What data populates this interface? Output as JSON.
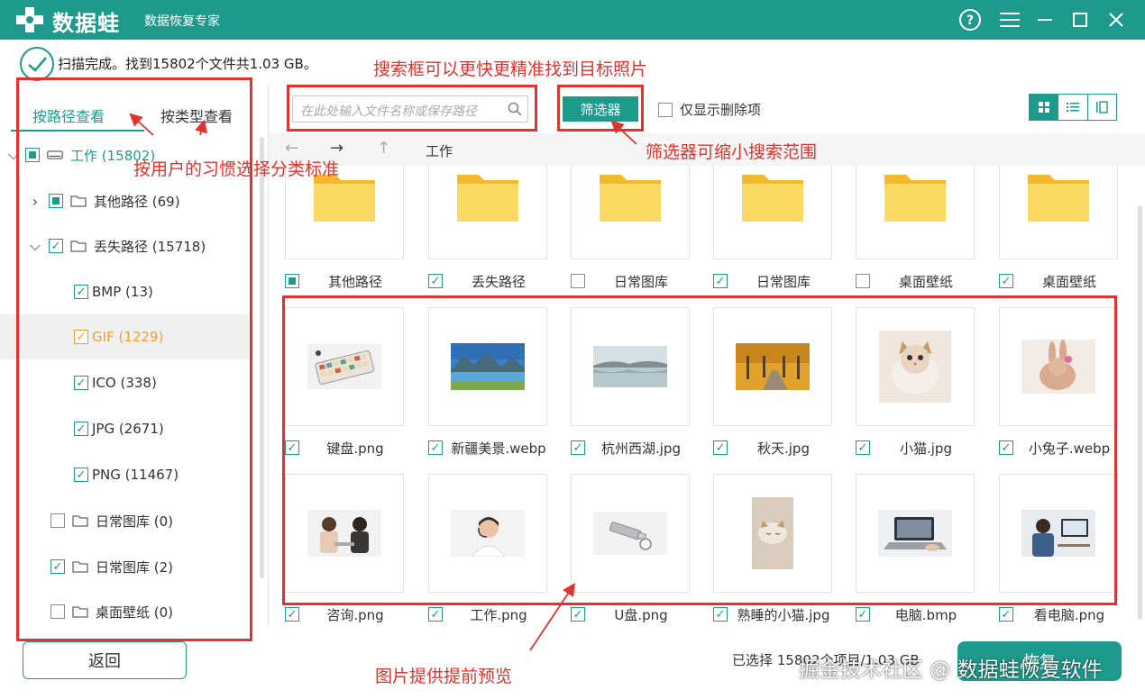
{
  "app": {
    "name": "数据蛙",
    "subtitle": "数据恢复专家"
  },
  "status": {
    "text": "扫描完成。找到15802个文件共1.03 GB。"
  },
  "annotations": {
    "search_tip": "搜索框可以更快更精准找到目标照片",
    "classify_tip": "按用户的习惯选择分类标准",
    "filter_tip": "筛选器可缩小搜索范围",
    "preview_tip": "图片提供提前预览"
  },
  "sidebar": {
    "tabs": [
      {
        "label": "按路径查看"
      },
      {
        "label": "按类型查看"
      }
    ],
    "tree": [
      {
        "label": "工作 (15802)",
        "state": "partial"
      },
      {
        "label": "其他路径 (69)",
        "state": "partial"
      },
      {
        "label": "丢失路径 (15718)",
        "state": "checked"
      },
      {
        "label": "BMP (13)",
        "state": "checked"
      },
      {
        "label": "GIF (1229)",
        "state": "checked"
      },
      {
        "label": "ICO (338)",
        "state": "checked"
      },
      {
        "label": "JPG (2671)",
        "state": "checked"
      },
      {
        "label": "PNG (11467)",
        "state": "checked"
      },
      {
        "label": "日常图库 (0)",
        "state": "unchecked"
      },
      {
        "label": "日常图库 (2)",
        "state": "checked"
      },
      {
        "label": "桌面壁纸 (0)",
        "state": "unchecked"
      }
    ]
  },
  "toolbar": {
    "search_placeholder": "在此处输入文件名称或保存路径",
    "filter_label": "筛选器",
    "only_deleted_label": "仅显示删除项"
  },
  "nav": {
    "breadcrumb": "工作",
    "back_arrow": "←",
    "forward_arrow": "→",
    "up_arrow": "↑"
  },
  "folders": [
    {
      "name": "其他路径",
      "state": "partial"
    },
    {
      "name": "丢失路径",
      "state": "checked"
    },
    {
      "name": "日常图库",
      "state": "unchecked"
    },
    {
      "name": "日常图库",
      "state": "checked"
    },
    {
      "name": "桌面壁纸",
      "state": "unchecked"
    },
    {
      "name": "桌面壁纸",
      "state": "checked"
    }
  ],
  "images": [
    {
      "name": "键盘.png",
      "icon": "keyboard-photo"
    },
    {
      "name": "新疆美景.webp",
      "icon": "lake-mountain-photo"
    },
    {
      "name": "杭州西湖.jpg",
      "icon": "west-lake-photo"
    },
    {
      "name": "秋天.jpg",
      "icon": "autumn-road-photo"
    },
    {
      "name": "小猫.jpg",
      "icon": "kitten-photo"
    },
    {
      "name": "小兔子.webp",
      "icon": "rabbit-photo"
    },
    {
      "name": "咨询.png",
      "icon": "consultation-photo"
    },
    {
      "name": "工作.png",
      "icon": "headset-woman-photo"
    },
    {
      "name": "U盘.png",
      "icon": "usb-drive-photo"
    },
    {
      "name": "熟睡的小猫.jpg",
      "icon": "sleeping-kitten-photo"
    },
    {
      "name": "电脑.bmp",
      "icon": "laptop-photo"
    },
    {
      "name": "看电脑.png",
      "icon": "man-at-computer-photo"
    }
  ],
  "footer": {
    "back_label": "返回",
    "selected_info": "已选择 15802个项目/1.03 GB",
    "recover_label": "恢复",
    "watermark": "掘金技术社区 @ 数据蛙恢复软件"
  },
  "colors": {
    "accent": "#1e9a8d",
    "annotation": "#e2322d",
    "folder": "#f7c948"
  }
}
